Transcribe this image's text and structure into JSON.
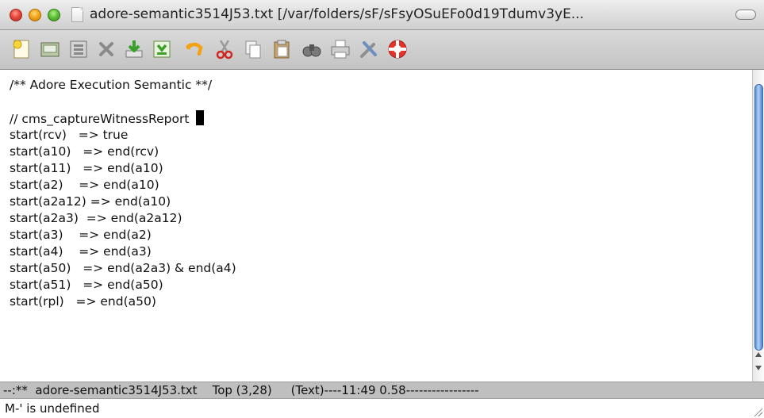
{
  "window": {
    "title": "adore-semantic3514J53.txt [/var/folders/sF/sFsyOSuEFo0d19Tdumv3yE..."
  },
  "toolbar": {
    "buttons": [
      {
        "icon": "new-file-icon"
      },
      {
        "icon": "open-folder-icon"
      },
      {
        "icon": "open-directory-icon"
      },
      {
        "icon": "close-buffer-icon"
      },
      {
        "icon": "save-icon"
      },
      {
        "icon": "save-as-icon"
      },
      {
        "icon": "undo-icon"
      },
      {
        "icon": "cut-icon"
      },
      {
        "icon": "copy-icon"
      },
      {
        "icon": "paste-icon"
      },
      {
        "icon": "search-icon"
      },
      {
        "icon": "print-icon"
      },
      {
        "icon": "preferences-icon"
      },
      {
        "icon": "help-icon"
      }
    ]
  },
  "editor": {
    "lines": [
      "/** Adore Execution Semantic **/",
      "",
      "// cms_captureWitnessReport ",
      "start(rcv)   => true",
      "start(a10)   => end(rcv)",
      "start(a11)   => end(a10)",
      "start(a2)    => end(a10)",
      "start(a2a12) => end(a10)",
      "start(a2a3)  => end(a2a12)",
      "start(a3)    => end(a2)",
      "start(a4)    => end(a3)",
      "start(a50)   => end(a2a3) & end(a4)",
      "start(a51)   => end(a50)",
      "start(rpl)   => end(a50)"
    ]
  },
  "modeline": {
    "text": "--:**  adore-semantic3514J53.txt    Top (3,28)     (Text)----11:49 0.58-----------------"
  },
  "minibuffer": {
    "text": "M-' is undefined"
  }
}
